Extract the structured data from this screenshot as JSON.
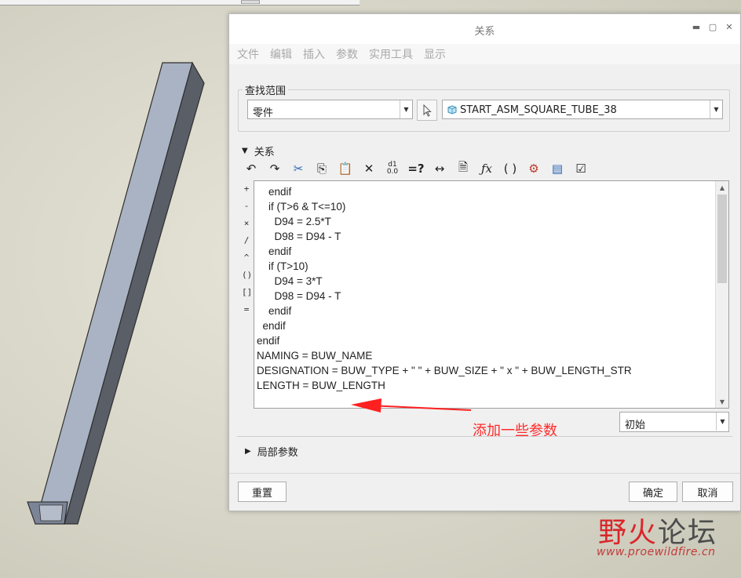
{
  "dialog": {
    "title": "关系",
    "menus": [
      "文件",
      "编辑",
      "插入",
      "参数",
      "实用工具",
      "显示"
    ]
  },
  "scope": {
    "legend": "查找范围",
    "type_value": "零件",
    "model_value": "START_ASM_SQUARE_TUBE_38"
  },
  "relations": {
    "header": "关系",
    "toolbar": [
      "undo-icon",
      "redo-icon",
      "cut-icon",
      "copy-icon",
      "paste-icon",
      "delete-icon",
      "units-icon",
      "evaluate-icon",
      "dimension-icon",
      "model-info-icon",
      "function-icon",
      "brackets-icon",
      "verify-icon",
      "sort-icon",
      "check-icon"
    ],
    "operators": [
      "+",
      "-",
      "×",
      "/",
      "^",
      "()",
      "[]",
      "="
    ],
    "code": "    endif\n    if (T>6 & T<=10)\n      D94 = 2.5*T\n      D98 = D94 - T\n    endif\n    if (T>10)\n      D94 = 3*T\n      D98 = D94 - T\n    endif\n  endif\nendif\nNAMING = BUW_NAME\nDESIGNATION = BUW_TYPE + \" \" + BUW_SIZE + \" x \" + BUW_LENGTH_STR\nLENGTH = BUW_LENGTH",
    "state_value": "初始"
  },
  "local_params": {
    "header": "局部参数"
  },
  "annotation": {
    "text": "添加一些参数",
    "color": "#ff2b2b"
  },
  "buttons": {
    "reset": "重置",
    "ok": "确定",
    "cancel": "取消"
  },
  "watermark": {
    "title_red": "野火",
    "title_grey": "论坛",
    "url": "www.proewildfire.cn"
  }
}
